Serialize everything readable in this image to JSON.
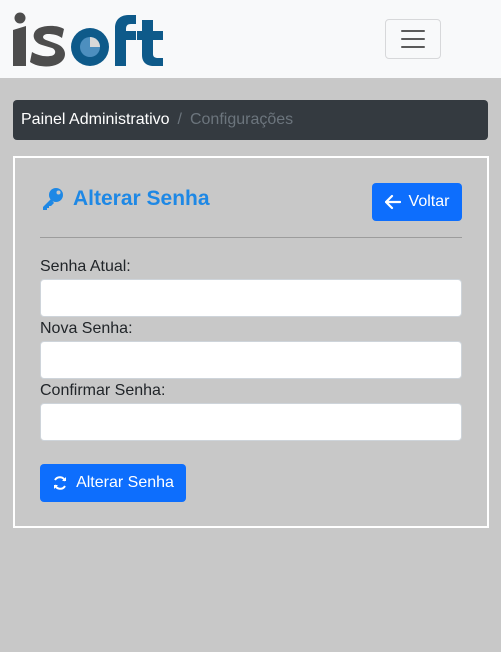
{
  "brand": {
    "name": "isoft",
    "colors": {
      "dark": "#4d4d4d",
      "blue": "#0e5a8a"
    }
  },
  "nav": {
    "toggle_icon": "hamburger-icon"
  },
  "breadcrumb": {
    "home": "Painel Administrativo",
    "separator": "/",
    "current": "Configurações"
  },
  "card": {
    "title": "Alterar Senha",
    "title_icon": "key-icon",
    "back_button": {
      "label": "Voltar",
      "icon": "arrow-left-icon"
    },
    "fields": [
      {
        "label": "Senha Atual:",
        "value": "",
        "placeholder": ""
      },
      {
        "label": "Nova Senha:",
        "value": "",
        "placeholder": ""
      },
      {
        "label": "Confirmar Senha:",
        "value": "",
        "placeholder": ""
      }
    ],
    "submit_button": {
      "label": "Alterar Senha",
      "icon": "refresh-icon"
    }
  },
  "colors": {
    "primary": "#0d6efd",
    "title": "#1e88e5",
    "breadcrumb_bg": "#343a40",
    "page_bg": "#c8c8c8"
  }
}
